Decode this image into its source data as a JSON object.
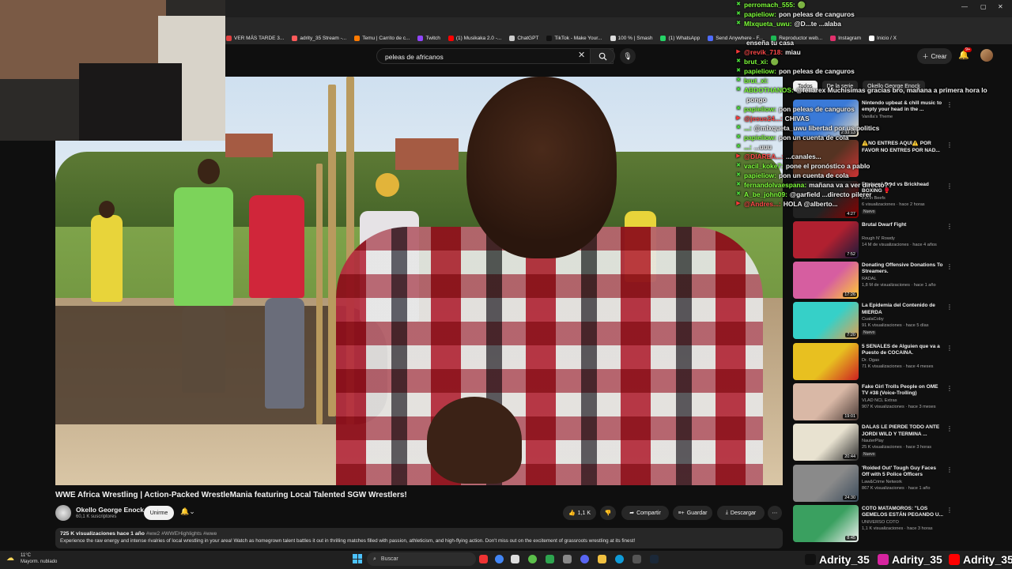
{
  "browser": {
    "bookmarks": [
      {
        "label": "VER MÁS TARDE 3...",
        "color": "#e04040"
      },
      {
        "label": "adrity_35 Stream -...",
        "color": "#ff5a5a"
      },
      {
        "label": "Temu | Carrito de c...",
        "color": "#ff7a00"
      },
      {
        "label": "Twitch",
        "color": "#9146ff"
      },
      {
        "label": "(1) Musikaka 2.0 -...",
        "color": "#ff0000"
      },
      {
        "label": "ChatGPT",
        "color": "#cccccc"
      },
      {
        "label": "TikTok - Make Your...",
        "color": "#111111"
      },
      {
        "label": "100 % | Smash",
        "color": "#dddddd"
      },
      {
        "label": "(1) WhatsApp",
        "color": "#25d366"
      },
      {
        "label": "Send Anywhere - F...",
        "color": "#4f6cff"
      },
      {
        "label": "Reproductor web...",
        "color": "#1db954"
      },
      {
        "label": "Instagram",
        "color": "#e1306c"
      },
      {
        "label": "Inicio / X",
        "color": "#ffffff"
      }
    ]
  },
  "youtube": {
    "search_query": "peleas de africanos",
    "create_label": "Crear",
    "notif_count": "9+"
  },
  "video": {
    "title": "WWE Africa Wrestling | Action-Packed WrestleMania featuring Local Talented SGW Wrestlers!",
    "channel": "Okello George Enock",
    "subscribers": "60,1 K suscriptores",
    "subscribe_label": "Unirme",
    "likes": "1,1 K",
    "share_label": "Compartir",
    "save_label": "Guardar",
    "download_label": "Descargar",
    "views_date": "725 K visualizaciones  hace 1 año",
    "tags": "#ww2 #WWEHighlights #wwe",
    "description": "Experience the raw energy and intense rivalries of local wrestling in your area! Watch as homegrown talent battles it out in thrilling matches filled with passion, athleticism, and high-flying action. Don't miss out on the excitement of grassroots wrestling at its finest!"
  },
  "sidebar": {
    "chips": [
      "Todos",
      "De la serie",
      "Okello George Enock"
    ],
    "items": [
      {
        "title": "Nintendo upbeat & chill music to empty your head in the ...",
        "channel": "Vanilla's Theme",
        "meta": "",
        "duration": "2:33:13",
        "new": "",
        "colors": [
          "#3a7ad8",
          "#f0e0c0"
        ]
      },
      {
        "title": "⚠️NO ENTRES AQUÍ⚠️ POR FAVOR NO ENTRES POR NAD...",
        "channel": "",
        "meta": "",
        "duration": "",
        "new": "",
        "colors": [
          "#553322",
          "#cc3333"
        ]
      },
      {
        "title": "Fentanyl Fred vs Brickhead BOXING 🥊",
        "channel": "Kevin Beefs",
        "meta": "6 visualizaciones · hace 2 horas",
        "duration": "4:27",
        "new": "Nuevo",
        "colors": [
          "#222222",
          "#8b0000"
        ]
      },
      {
        "title": "Brutal Dwarf Fight",
        "channel": "Rough N' Rowdy",
        "meta": "14 M de visualizaciones · hace 4 años",
        "duration": "7:52",
        "new": "",
        "colors": [
          "#b02030",
          "#1a1a3a"
        ]
      },
      {
        "title": "Donating Offensive Donations To Streamers.",
        "channel": "RADAL",
        "meta": "1,8 M de visualizaciones · hace 1 año",
        "duration": "17:26",
        "new": "",
        "colors": [
          "#d65ea0",
          "#ffcc33"
        ]
      },
      {
        "title": "La Epidemia del Contenido de MIERDA",
        "channel": "CualaCoby",
        "meta": "91 K visualizaciones · hace 5 días",
        "duration": "7:20",
        "new": "Nuevo",
        "colors": [
          "#36d0c8",
          "#e2a050"
        ]
      },
      {
        "title": "5 SEÑALES de Alguien que va a Puesto de COCAINA.",
        "channel": "Dr. Ogas",
        "meta": "71 K visualizaciones · hace 4 meses",
        "duration": "",
        "new": "",
        "colors": [
          "#e8c020",
          "#cc2020"
        ]
      },
      {
        "title": "Fake Girl Trolls People on OME TV #38 (Voice-Trolling)",
        "channel": "VLAD NCL Extras",
        "meta": "907 K visualizaciones · hace 3 meses",
        "duration": "19:01",
        "new": "",
        "colors": [
          "#d9b8a6",
          "#4a3a35"
        ]
      },
      {
        "title": "DALAS LE PIERDE TODO ANTE JORDI WILD Y TERMINA ...",
        "channel": "NauterPlay",
        "meta": "25 K visualizaciones · hace 3 horas",
        "duration": "20:44",
        "new": "Nuevo",
        "colors": [
          "#e8e2d0",
          "#2d2d2d"
        ]
      },
      {
        "title": "'Roided Out' Tough Guy Faces Off with 5 Police Officers",
        "channel": "Law&Crime Network",
        "meta": "867 K visualizaciones · hace 1 año",
        "duration": "24:30",
        "new": "",
        "colors": [
          "#8a8a8a",
          "#3a4a5a"
        ]
      },
      {
        "title": "COTO MATAMOROS: \"LOS GEMELOS ESTÁN PEGANDO U...",
        "channel": "UNIVERSO COTO",
        "meta": "1,1 K visualizaciones · hace 3 horas",
        "duration": "8:45",
        "new": "",
        "colors": [
          "#3aa060",
          "#f0f0f0"
        ]
      }
    ]
  },
  "chat": [
    {
      "badge": "green",
      "user": "perromach_555:",
      "msg": "🟢",
      "color": "#7fff3a"
    },
    {
      "badge": "green",
      "user": "papieliow:",
      "msg": "pon peleas de canguros",
      "color": "#7fff3a"
    },
    {
      "badge": "green",
      "user": "Mlxqueta_uwu:",
      "msg": "@D...te  ...alaba",
      "color": "#7fff3a"
    },
    {
      "badge": "",
      "user": "",
      "msg": "",
      "color": "#7fff3a"
    },
    {
      "badge": "",
      "user": "",
      "msg": "enseña tu casa",
      "color": "#7fff3a"
    },
    {
      "badge": "red",
      "user": "@revik_718:",
      "msg": "miau",
      "color": "#ff4a4a"
    },
    {
      "badge": "green",
      "user": "brut_xi:",
      "msg": "🟢",
      "color": "#7fff3a"
    },
    {
      "badge": "green",
      "user": "papieliow:",
      "msg": "pon peleas de canguros",
      "color": "#7fff3a"
    },
    {
      "badge": "green",
      "user": "brut_xi:",
      "msg": "",
      "color": "#7fff3a"
    },
    {
      "badge": "green",
      "user": "ABDOTHANOS:",
      "msg": "@fellarex Muchisimas gracias bro, mañana a primera hora lo",
      "color": "#7fff3a"
    },
    {
      "badge": "",
      "user": "",
      "msg": "pongo",
      "color": "#7fff3a"
    },
    {
      "badge": "green",
      "user": "papieliow:",
      "msg": "pon peleas de canguros",
      "color": "#7fff3a"
    },
    {
      "badge": "red",
      "user": "@jesus24...:",
      "msg": "CHIVAS",
      "color": "#ff4a4a"
    },
    {
      "badge": "green",
      "user": "...:",
      "msg": "@mlxqueta_uwu libertad por us politics",
      "color": "#7fff3a"
    },
    {
      "badge": "green",
      "user": "papieliow:",
      "msg": "pon un cuenta de cola",
      "color": "#7fff3a"
    },
    {
      "badge": "green",
      "user": "...:",
      "msg": "...uuu",
      "color": "#7fff3a"
    },
    {
      "badge": "red",
      "user": "@DIAREA...:",
      "msg": "...canales...",
      "color": "#ff4a4a"
    },
    {
      "badge": "green",
      "user": "vacil_koke7:",
      "msg": "pone el pronóstico a pablo",
      "color": "#7fff3a"
    },
    {
      "badge": "green",
      "user": "papieliow:",
      "msg": "pon un cuenta de cola",
      "color": "#7fff3a"
    },
    {
      "badge": "green",
      "user": "fernandolvaespana:",
      "msg": "mañana va a ver directo??",
      "color": "#7fff3a"
    },
    {
      "badge": "green",
      "user": "A_be_john09:",
      "msg": "@garfield ...directo pilerer",
      "color": "#7fff3a"
    },
    {
      "badge": "red",
      "user": "@Andres...:",
      "msg": "HOLA @alberto...",
      "color": "#ff4a4a"
    }
  ],
  "taskbar": {
    "weather_temp": "11°C",
    "weather_desc": "Mayorm. nublado",
    "search_label": "Buscar",
    "handles": [
      {
        "name": "Adrity_35",
        "color": "#111111"
      },
      {
        "name": "Adrity_35",
        "color": "#d6249f"
      },
      {
        "name": "Adrity_35",
        "color": "#ff0000"
      }
    ]
  }
}
